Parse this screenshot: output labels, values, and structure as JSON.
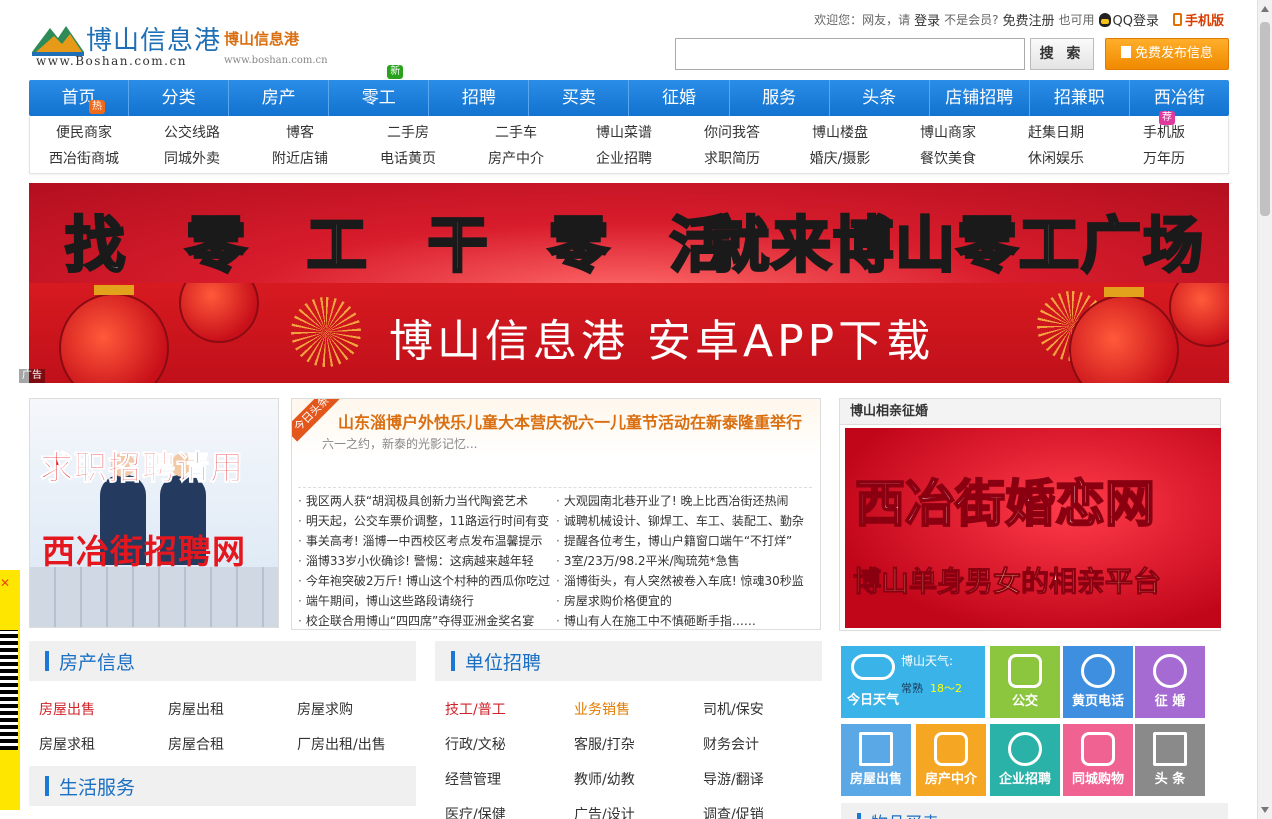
{
  "header": {
    "logo_cn": "博山信息港",
    "logo_en": "www.Boshan.com.cn",
    "sub_cn": "博山信息港",
    "sub_en": "www.boshan.com.cn",
    "welcome": "欢迎您：网友，请",
    "login": "登录",
    "not_member": "不是会员?",
    "register": "免费注册",
    "also": "也可用",
    "qq_login": "QQ登录",
    "mobile": "手机版",
    "search_button": "搜 索",
    "publish_button": "免费发布信息"
  },
  "nav": {
    "items": [
      "首页",
      "分类",
      "房产",
      "零工",
      "招聘",
      "买卖",
      "征婚",
      "服务",
      "头条",
      "店铺招聘",
      "招兼职",
      "西冶街"
    ],
    "badge_hot": "热",
    "badge_new": "新",
    "badge_rec": "荐"
  },
  "subnav": {
    "row1": [
      "便民商家",
      "公交线路",
      "博客",
      "二手房",
      "二手车",
      "博山菜谱",
      "你问我答",
      "博山楼盘",
      "博山商家",
      "赶集日期",
      "手机版"
    ],
    "row2": [
      "西冶街商城",
      "同城外卖",
      "附近店铺",
      "电话黄页",
      "房产中介",
      "企业招聘",
      "求职简历",
      "婚庆/摄影",
      "餐饮美食",
      "休闲娱乐",
      "万年历"
    ]
  },
  "banners": {
    "b1_left": "找 零 工 干 零 活",
    "b1_right": "就来博山零工广场",
    "b2": "博山信息港  安卓APP下载",
    "ad_tag": "广告"
  },
  "job_ad": {
    "line1": "求职招聘请用",
    "line2": "西冶街招聘网"
  },
  "news": {
    "today_tag": "今日头条",
    "headline": "山东淄博户外快乐儿童大本营庆祝六一儿童节活动在新泰隆重举行",
    "headline_sub": "六一之约，新泰的光影记忆...",
    "left": [
      "我区两人获“胡润极具创新力当代陶瓷艺术",
      "明天起，公交车票价调整，11路运行时间有变",
      "事关高考! 淄博一中西校区考点发布温馨提示",
      "淄博33岁小伙确诊! 警惕：这病越来越年轻",
      "今年袍突破2万斤! 博山这个村种的西瓜你吃过",
      "端午期间，博山这些路段请绕行",
      "校企联合用博山“四四席”夺得亚洲金奖名宴"
    ],
    "right": [
      "大观园南北巷开业了! 晚上比西冶街还热闹",
      "诚聘机械设计、铆焊工、车工、装配工、勤杂",
      "提醒各位考生，博山户籍窗口端午“不打烊”",
      "3室/23万/98.2平米/陶琉苑*急售",
      "淄博街头，有人突然被卷入车底! 惊魂30秒监",
      "房屋求购价格便宜的",
      "博山有人在施工中不慎砸断手指……"
    ]
  },
  "marry": {
    "title": "博山相亲征婚",
    "ad_line1": "西冶街婚恋网",
    "ad_line2": "博山单身男女的相亲平台"
  },
  "house": {
    "title": "房产信息",
    "row1": [
      "房屋出售",
      "房屋出租",
      "房屋求购"
    ],
    "row2": [
      "房屋求租",
      "房屋合租",
      "厂房出租/出售"
    ]
  },
  "life": {
    "title": "生活服务"
  },
  "jobs": {
    "title": "单位招聘",
    "row1": [
      "技工/普工",
      "业务销售",
      "司机/保安"
    ],
    "row2": [
      "行政/文秘",
      "客服/打杂",
      "财务会计"
    ],
    "row3": [
      "经营管理",
      "教师/幼教",
      "导游/翻译"
    ],
    "row4": [
      "医疗/保健",
      "广告/设计",
      "调查/促销"
    ]
  },
  "services": {
    "weather_title": "博山天气:",
    "weather_desc": "常熟",
    "weather_temp": "18～2",
    "weather_label": "今日天气",
    "tiles": [
      "公交",
      "黄页电话",
      "征 婚",
      "房屋出售",
      "房产中介",
      "企业招聘",
      "同城购物",
      "头 条"
    ],
    "next_title": "物品买卖"
  },
  "colors": {
    "nav_blue": "#1a7fdc",
    "brand_orange": "#f08a00",
    "title_blue": "#1a6fc4",
    "highlight_red": "#d2232a"
  }
}
